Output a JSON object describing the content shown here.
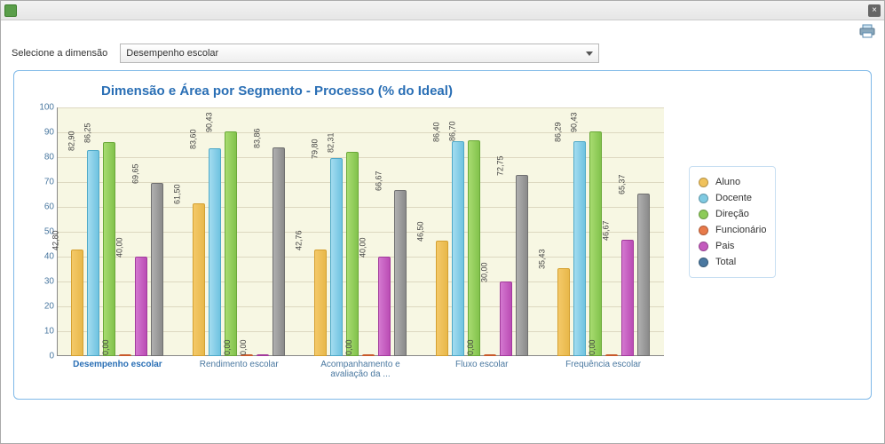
{
  "titlebar": {
    "close_tooltip": "Fechar",
    "print_tooltip": "Imprimir"
  },
  "controls": {
    "label": "Selecione a dimensão",
    "selected": "Desempenho escolar"
  },
  "chart_data": {
    "type": "bar",
    "title": "Dimensão e Área por Segmento - Processo (% do Ideal)",
    "ylabel": "",
    "ylim": [
      0,
      100
    ],
    "yticks": [
      0,
      10,
      20,
      30,
      40,
      50,
      60,
      70,
      80,
      90,
      100
    ],
    "categories": [
      "Desempenho escolar",
      "Rendimento escolar",
      "Acompanhamento e avaliação da ...",
      "Fluxo escolar",
      "Frequência escolar"
    ],
    "series": [
      {
        "name": "Aluno",
        "color": "#f0c25c",
        "values": [
          42.8,
          61.5,
          42.76,
          46.5,
          35.43
        ]
      },
      {
        "name": "Docente",
        "color": "#7fcae2",
        "values": [
          82.9,
          83.6,
          79.8,
          86.4,
          86.29
        ]
      },
      {
        "name": "Direção",
        "color": "#8dcb58",
        "values": [
          86.25,
          90.43,
          82.31,
          86.7,
          90.43
        ]
      },
      {
        "name": "Funcionário",
        "color": "#e87a4a",
        "values": [
          0.0,
          0.0,
          0.0,
          0.0,
          0.0
        ]
      },
      {
        "name": "Pais",
        "color": "#c45abe",
        "values": [
          40.0,
          0.0,
          40.0,
          30.0,
          46.67
        ]
      },
      {
        "name": "Total",
        "color": "#8a8a8a",
        "values": [
          69.65,
          83.86,
          66.67,
          72.75,
          65.37
        ]
      }
    ],
    "labels_fmt": [
      [
        "42,80",
        "82,90",
        "86,25",
        "0,00",
        "40,00",
        "69,65"
      ],
      [
        "61,50",
        "83,60",
        "90,43",
        "0,00",
        "0,00",
        "83,86"
      ],
      [
        "42,76",
        "79,80",
        "82,31",
        "0,00",
        "40,00",
        "66,67"
      ],
      [
        "46,50",
        "86,40",
        "86,70",
        "0,00",
        "30,00",
        "72,75"
      ],
      [
        "35,43",
        "86,29",
        "90,43",
        "0,00",
        "46,67",
        "65,37"
      ]
    ],
    "highlight_category_index": 0
  },
  "legend": {
    "items": [
      "Aluno",
      "Docente",
      "Direção",
      "Funcionário",
      "Pais",
      "Total"
    ]
  }
}
